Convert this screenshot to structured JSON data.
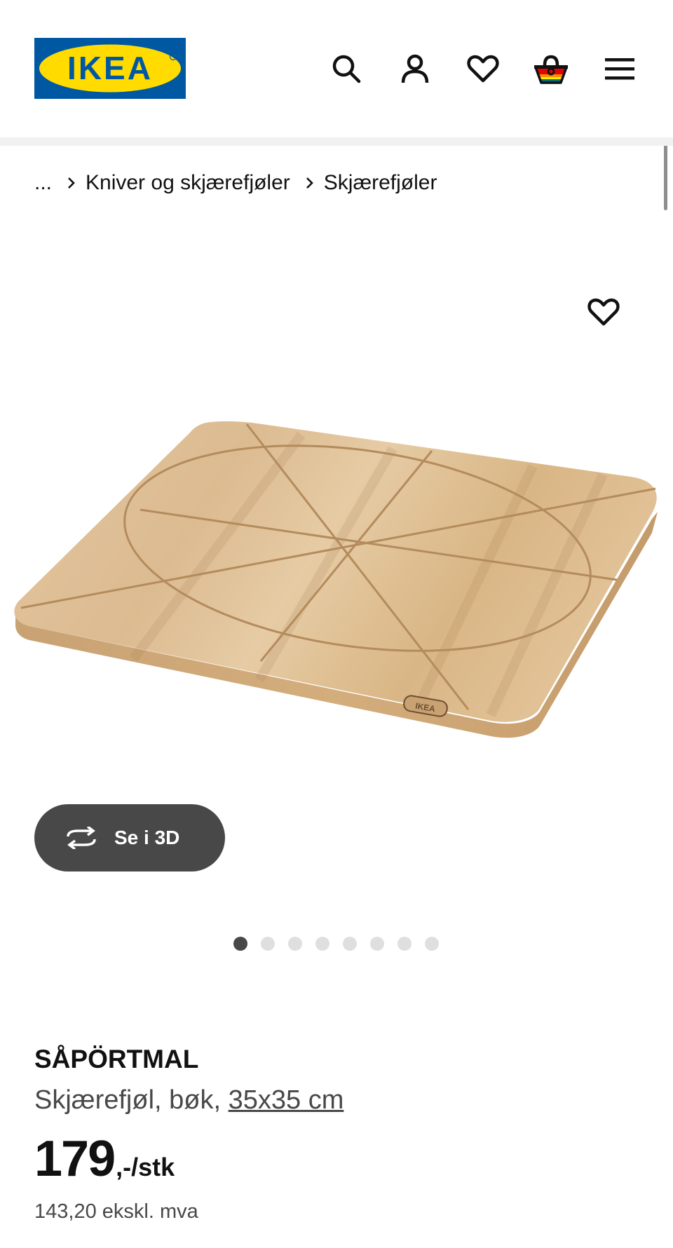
{
  "brand": {
    "logo_text": "IKEA",
    "colors": {
      "blue": "#0058a3",
      "yellow": "#ffdb00"
    }
  },
  "header": {
    "icons": [
      "search-icon",
      "account-icon",
      "wishlist-heart-icon",
      "shopping-basket-icon",
      "hamburger-menu-icon"
    ]
  },
  "breadcrumb": {
    "ellipsis": "...",
    "items": [
      "Kniver og skjærefjøler",
      "Skjærefjøler"
    ]
  },
  "gallery": {
    "view_3d_label": "Se i 3D",
    "image_count": 8,
    "active_index": 0
  },
  "product": {
    "name": "SÅPÖRTMAL",
    "description": "Skjærefjøl, bøk, ",
    "size_link": "35x35 cm",
    "price_amount": "179",
    "price_unit": ",-/stk",
    "price_ex_vat": "143,20 ekskl. mva"
  },
  "colors": {
    "button_dark": "#484848",
    "text_primary": "#111111",
    "text_secondary": "#484848",
    "dot_inactive": "#dfdfdf"
  }
}
